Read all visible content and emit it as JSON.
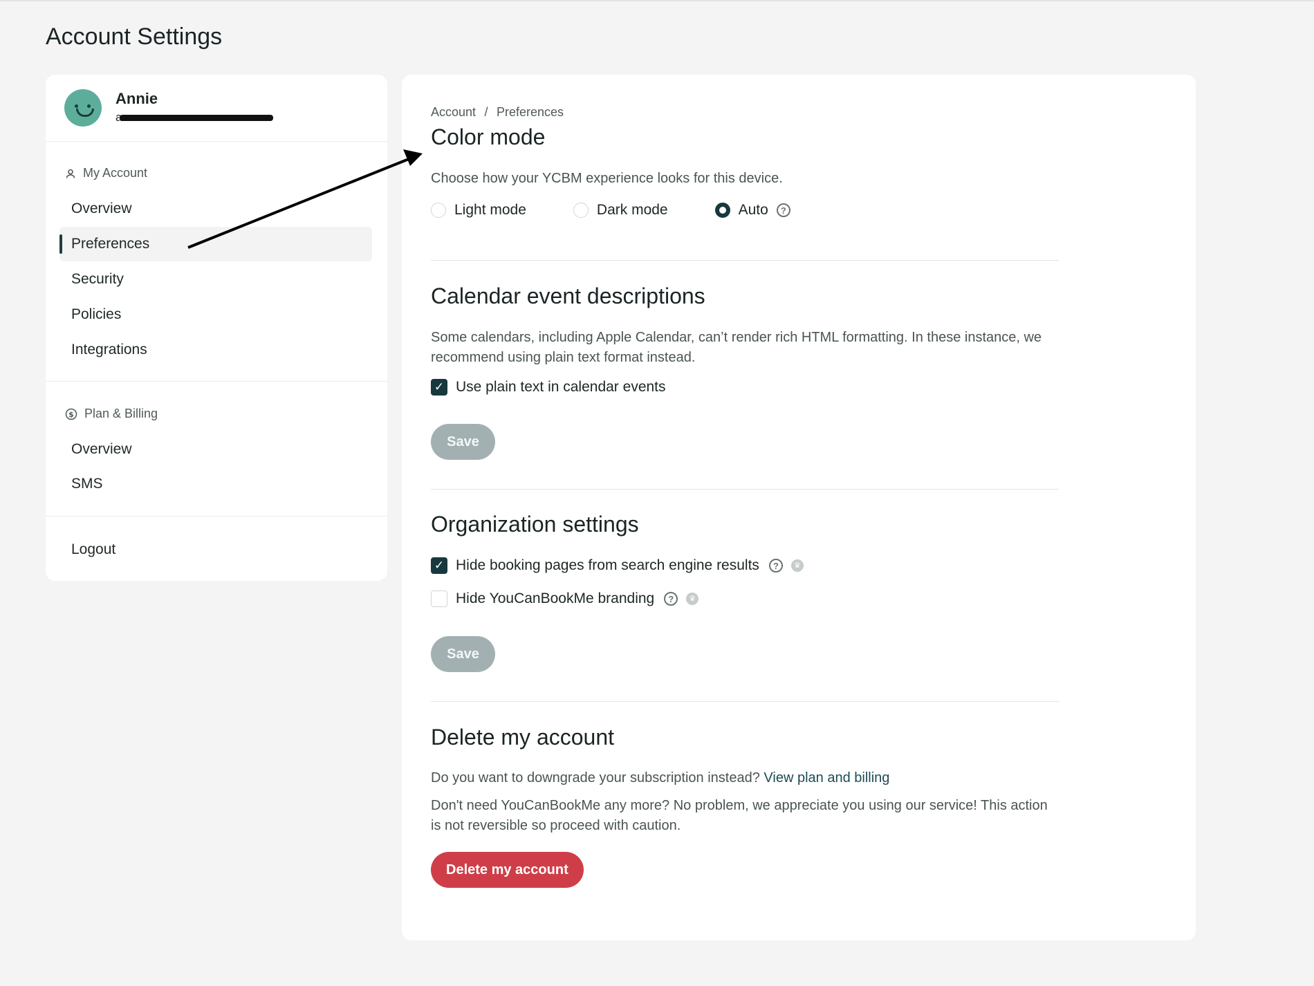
{
  "page": {
    "title": "Account Settings"
  },
  "profile": {
    "name": "Annie",
    "email": "a"
  },
  "sidebar": {
    "my_account": {
      "header": "My Account",
      "items": [
        "Overview",
        "Preferences",
        "Security",
        "Policies",
        "Integrations"
      ],
      "active": "Preferences"
    },
    "billing": {
      "header": "Plan & Billing",
      "items": [
        "Overview",
        "SMS"
      ]
    },
    "logout": "Logout"
  },
  "breadcrumb": {
    "parent": "Account",
    "separator": "/",
    "current": "Preferences"
  },
  "color_mode": {
    "title": "Color mode",
    "description": "Choose how your YCBM experience looks for this device.",
    "options": [
      "Light mode",
      "Dark mode",
      "Auto"
    ],
    "selected": "Auto"
  },
  "calendar": {
    "title": "Calendar event descriptions",
    "description": "Some calendars, including Apple Calendar, can’t render rich HTML formatting. In these instance, we recommend using plain text format instead.",
    "checkbox_label": "Use plain text in calendar events",
    "checked": true,
    "save_label": "Save"
  },
  "organization": {
    "title": "Organization settings",
    "hide_search_label": "Hide booking pages from search engine results",
    "hide_search_checked": true,
    "hide_branding_label": "Hide YouCanBookMe branding",
    "hide_branding_checked": false,
    "save_label": "Save"
  },
  "delete": {
    "title": "Delete my account",
    "downgrade_text": "Do you want to downgrade your subscription instead?",
    "downgrade_link": "View plan and billing",
    "warning": "Don't need YouCanBookMe any more? No problem, we appreciate you using our service! This action is not reversible so proceed with caution.",
    "button_label": "Delete my account",
    "button_color": "#cf3e48"
  },
  "colors": {
    "accent": "#18383d",
    "link": "#1b4b55",
    "save_disabled": "#a2b0b2"
  }
}
